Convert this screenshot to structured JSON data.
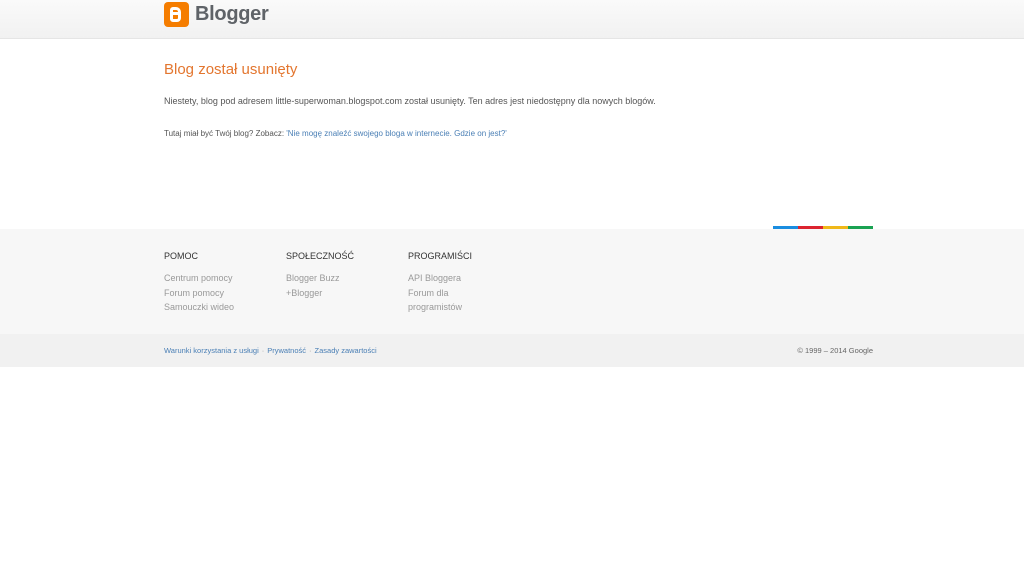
{
  "header": {
    "logo_text": "Blogger",
    "logo_icon": "blogger-logo-icon"
  },
  "main": {
    "title": "Blog został usunięty",
    "message": "Niestety, blog pod adresem little-superwoman.blogspot.com został usunięty. Ten adres jest niedostępny dla nowych blogów.",
    "help_prefix": "Tutaj miał być Twój blog? Zobacz: ",
    "help_link": "'Nie mogę znaleźć swojego bloga w internecie. Gdzie on jest?'"
  },
  "colorbar": {
    "colors": [
      "#1a8de0",
      "#dc2430",
      "#f0b819",
      "#1aa252"
    ]
  },
  "footer": {
    "columns": [
      {
        "heading": "POMOC",
        "links": [
          "Centrum pomocy",
          "Forum pomocy",
          "Samouczki wideo"
        ]
      },
      {
        "heading": "SPOŁECZNOŚĆ",
        "links": [
          "Blogger Buzz",
          "+Blogger"
        ]
      },
      {
        "heading": "PROGRAMIŚCI",
        "links": [
          "API Bloggera",
          "Forum dla",
          "programistów"
        ]
      }
    ],
    "legal_links": [
      "Warunki korzystania z usługi",
      "Prywatność",
      "Zasady zawartości"
    ],
    "separator": "·",
    "copyright": "© 1999 – 2014 Google"
  }
}
